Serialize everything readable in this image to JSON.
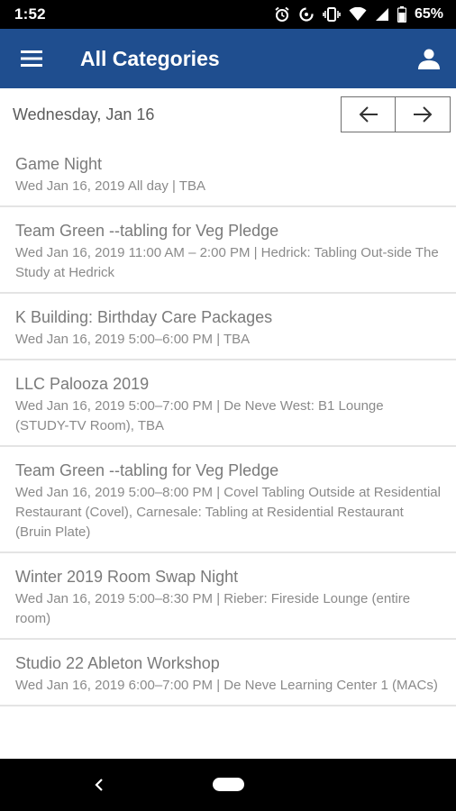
{
  "status_bar": {
    "time": "1:52",
    "battery": "65%",
    "icons": [
      "alarm-icon",
      "data-saver-icon",
      "vibrate-icon",
      "wifi-icon",
      "signal-icon",
      "battery-icon"
    ]
  },
  "app_bar": {
    "title": "All Categories",
    "menu_icon": "hamburger-menu-icon",
    "user_icon": "user-profile-icon",
    "color": "#1f4e8f"
  },
  "date_nav": {
    "date": "Wednesday, Jan 16",
    "prev_icon": "arrow-left-icon",
    "next_icon": "arrow-right-icon"
  },
  "events": [
    {
      "title": "Game Night",
      "meta": "Wed Jan 16, 2019 All day  | TBA"
    },
    {
      "title": "Team Green --tabling for Veg Pledge",
      "meta": "Wed Jan 16, 2019 11:00 AM – 2:00 PM  | Hedrick: Tabling Out-side The Study at Hedrick"
    },
    {
      "title": "K Building: Birthday Care Packages",
      "meta": "Wed Jan 16, 2019 5:00–6:00 PM  | TBA"
    },
    {
      "title": "LLC Palooza 2019",
      "meta": "Wed Jan 16, 2019 5:00–7:00 PM  | De Neve West: B1 Lounge (STUDY-TV Room), TBA"
    },
    {
      "title": "Team Green --tabling for Veg Pledge",
      "meta": "Wed Jan 16, 2019 5:00–8:00 PM  | Covel Tabling Outside at Residential Restaurant (Covel), Carnesale: Tabling at Residential Restaurant (Bruin Plate)"
    },
    {
      "title": "Winter 2019 Room Swap Night",
      "meta": "Wed Jan 16, 2019 5:00–8:30 PM  | Rieber: Fireside Lounge (entire room)"
    },
    {
      "title": "Studio 22 Ableton Workshop",
      "meta": "Wed Jan 16, 2019 6:00–7:00 PM  | De Neve Learning Center 1 (MACs)"
    }
  ],
  "nav_bar": {
    "back_icon": "back-chevron-icon",
    "home_icon": "home-pill-icon"
  }
}
